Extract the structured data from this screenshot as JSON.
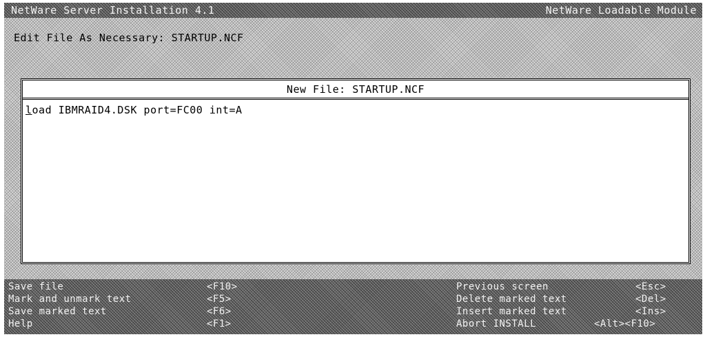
{
  "titlebar": {
    "left": "NetWare Server Installation  4.1",
    "right": "NetWare Loadable Module"
  },
  "prompt": "Edit File As Necessary: STARTUP.NCF",
  "editor": {
    "title": "New File: STARTUP.NCF",
    "cursor_char": "l",
    "line_rest": "oad IBMRAID4.DSK port=FC00 int=A"
  },
  "keys": {
    "left": [
      {
        "label": "Save file",
        "key": "<F10>"
      },
      {
        "label": "Mark and unmark text",
        "key": "<F5>"
      },
      {
        "label": "Save marked text",
        "key": "<F6>"
      },
      {
        "label": "Help",
        "key": "<F1>"
      }
    ],
    "right": [
      {
        "label": "Previous screen",
        "key": "<Esc>"
      },
      {
        "label": "Delete marked text",
        "key": "<Del>"
      },
      {
        "label": "Insert marked text",
        "key": "<Ins>"
      },
      {
        "label": "Abort INSTALL",
        "key": "<Alt><F10>"
      }
    ]
  }
}
